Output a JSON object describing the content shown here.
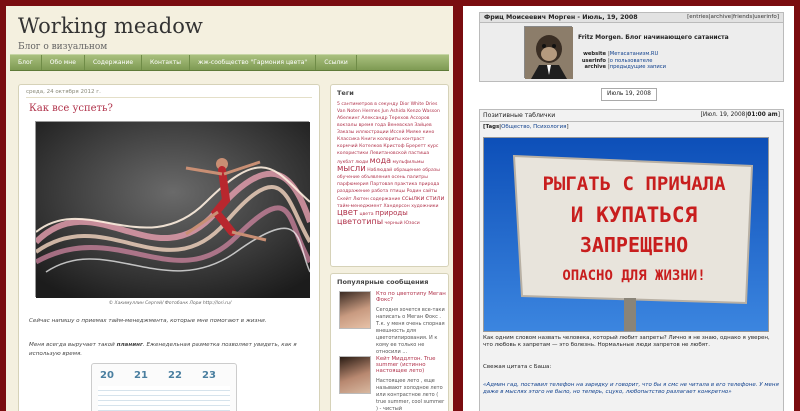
{
  "left": {
    "site_title": "Working meadow",
    "site_tagline": "Блог о визуальном",
    "nav": [
      "Блог",
      "Обо мне",
      "Содержание",
      "Контакты",
      "жж-сообщество \"Гармония цвета\"",
      "Ссылки"
    ],
    "post": {
      "date": "среда, 24 октября 2012 г.",
      "title": "Как все успеть?",
      "photo_caption": "© Хакимуллин Сергей/ Фотобанк Лори http://lori.ru/",
      "para1": "Сейчас напишу о приемах тайм-менеджмента, которые мне помогают в жизни.",
      "para2_before": "Меня всегда выручает такой ",
      "para2_bold": "планинг",
      "para2_after": ". Еженедельная разметка позволяет увидеть, как я использую время.",
      "planner_days": [
        "20",
        "21",
        "22",
        "23"
      ]
    },
    "tags_box": {
      "title": "Теги",
      "tags": [
        "5 сантиметров в секунду",
        "Dior",
        "White",
        "Dries Van Noten",
        "Hermes",
        "Jun Ashida",
        "Kenzo",
        "Wasson",
        "Абелкинг",
        "Александр",
        "Терехов",
        "Ассоров",
        "вокзалы",
        "время",
        "года",
        "Веневская",
        "Зайцев",
        "Заказы",
        "иллюстрации",
        "Иссей",
        "Мияке",
        "кино",
        "Классика",
        "Книги",
        "колориты",
        "контраст",
        "кормчий",
        "Котелков",
        "Кристоф",
        "Бреретт",
        "курс",
        "колористики",
        "Левитановской",
        "пастиша",
        "лукбат",
        "люди",
        "мода",
        "мульфильмы",
        "мысли",
        "Наблюдай",
        "обращение",
        "образы",
        "обучение",
        "объявления",
        "осень",
        "палитры",
        "парфюмерия",
        "Партовая",
        "практика",
        "природа",
        "раздражение",
        "работа",
        "птицы",
        "Родин",
        "сайты",
        "Скейт",
        "Лютен",
        "содержание",
        "ссылки",
        "стили",
        "тайм-менеджмент",
        "Хандерсон",
        "художники",
        "цвет",
        "цвета",
        "природы",
        "цветотипы",
        "черный",
        "Юзоси"
      ]
    },
    "popular": {
      "title": "Популярные сообщения",
      "items": [
        {
          "link": "Кто по цветотипу Меган Фокс?",
          "excerpt": "Сегодня хочется все-таки написать о Меган Фокс . Т.к. у меня очень спорная внешность для цветотипирования. И к кому ее только не относили ..."
        },
        {
          "link": "Кейт Миддлтон. True summer (истинно настоящее лето)",
          "excerpt": "Настоящее лето , еще называют холодное лето или контрастное лето ( true summer, cool summer ) - чистый"
        }
      ]
    }
  },
  "right": {
    "header_name": "Фриц Моисеевич Морген - Июль, 19, 2008",
    "header_links": "[entries|archive|friends|userinfo]",
    "journal_title": "Fritz Morgen. Блог начинающего сатаниста",
    "info": [
      {
        "label": "website",
        "value": "Метасатанизм.RU"
      },
      {
        "label": "userinfo",
        "value": "о пользователе"
      },
      {
        "label": "archive",
        "value": "предыдущие записи"
      }
    ],
    "date_box": "Июль 19, 2008",
    "entry": {
      "title": "Позитивные таблички",
      "date": "[Июл. 19, 2008|",
      "time": "01:00 am",
      "tags_prefix": "[Tags|",
      "tags": "Общество, Психология",
      "tags_suffix": "]",
      "sign_lines": [
        "РЫГАТЬ С ПРИЧАЛА",
        "И КУПАТЬСЯ",
        "ЗАПРЕЩЕНО",
        "ОПАСНО ДЛЯ ЖИЗНИ!"
      ],
      "text1": "Как одним словом назвать человека, который любит запреты? Лично я не знаю, однако я уверен, что любовь к запретам — это болезнь. Нормальные люди запретов не любят.",
      "text2": "Свежая цитата с Баша:",
      "quote": "«Админ гад, поставил телефон на зарядку и говорит, что бы я смс не читала в его телефоне. У меня даже в мыслях этого не было, но теперь, сцуко, любопытство разлагает конкретно»"
    }
  },
  "colors": {
    "frame": "#7a0d10",
    "nav_green": "#8aa65e",
    "link_red": "#b0324a",
    "link_blue": "#0e3f8c",
    "sky": "#1d5fc4"
  }
}
